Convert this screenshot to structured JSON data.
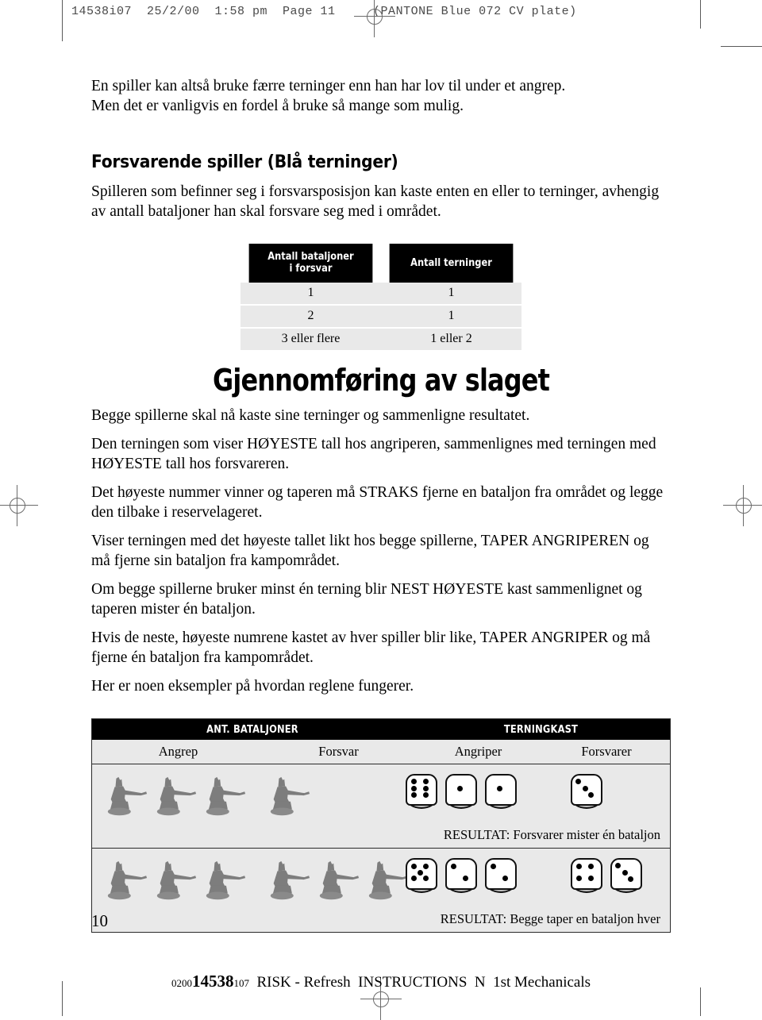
{
  "prepress": {
    "header": "14538i07  25/2/00  1:58 pm  Page 11     (PANTONE Blue 072 CV plate)"
  },
  "page": {
    "folio": "10",
    "imprint_prefix": "0200",
    "imprint_bold": "14538",
    "imprint_suffix": "107",
    "imprint_rest": "RISK - Refresh  INSTRUCTIONS  N  1st Mechanicals"
  },
  "intro": {
    "line1": "En spiller kan altså bruke færre terninger enn han har lov til under et angrep.",
    "line2": "Men det er vanligvis en fordel å bruke så mange som mulig."
  },
  "section": {
    "heading": "Forsvarende spiller (Blå terninger)",
    "paragraph": "Spilleren som befinner seg i forsvarsposisjon kan kaste enten en eller to terninger, avhengig av antall bataljoner han skal forsvare seg med i området."
  },
  "dice_table": {
    "header_left_line1": "Antall bataljoner",
    "header_left_line2": "i forsvar",
    "header_right": "Antall terninger",
    "rows": [
      {
        "battalions": "1",
        "dice": "1"
      },
      {
        "battalions": "2",
        "dice": "1"
      },
      {
        "battalions": "3 eller flere",
        "dice": "1 eller 2"
      }
    ]
  },
  "battle": {
    "heading": "Gjennomføring av slaget",
    "paragraphs": [
      "Begge spillerne skal nå kaste sine terninger og sammenligne resultatet.",
      "Den terningen som viser HØYESTE tall hos angriperen, sammenlignes med terningen med HØYESTE tall hos forsvareren.",
      "Det høyeste nummer vinner og taperen må STRAKS fjerne en bataljon fra området og legge den tilbake i reservelageret.",
      "Viser terningen med det høyeste tallet likt hos begge spillerne, TAPER ANGRIPEREN og må fjerne sin bataljon fra kampområdet.",
      "Om begge spillerne bruker minst én terning blir NEST HØYESTE kast sammenlignet og taperen mister én bataljon.",
      "Hvis de neste, høyeste numrene kastet av hver spiller blir like, TAPER ANGRIPER og må fjerne én bataljon fra kampområdet.",
      "Her er noen eksempler på hvordan reglene fungerer."
    ]
  },
  "example_table": {
    "group_headers": {
      "battalions": "ANT. BATALJONER",
      "dice_rolls": "TERNINGKAST"
    },
    "column_headers": {
      "attack": "Angrep",
      "defense": "Forsvar",
      "attacker": "Angriper",
      "defender": "Forsvarer"
    },
    "rows": [
      {
        "attack_figures": 3,
        "defense_figures": 1,
        "attacker_dice": [
          6,
          1,
          1
        ],
        "defender_dice": [
          3
        ],
        "result": "RESULTAT: Forsvarer mister én bataljon"
      },
      {
        "attack_figures": 3,
        "defense_figures": 3,
        "attacker_dice": [
          5,
          2,
          2
        ],
        "defender_dice": [
          4,
          3
        ],
        "result": "RESULTAT: Begge taper en bataljon hver"
      }
    ]
  }
}
